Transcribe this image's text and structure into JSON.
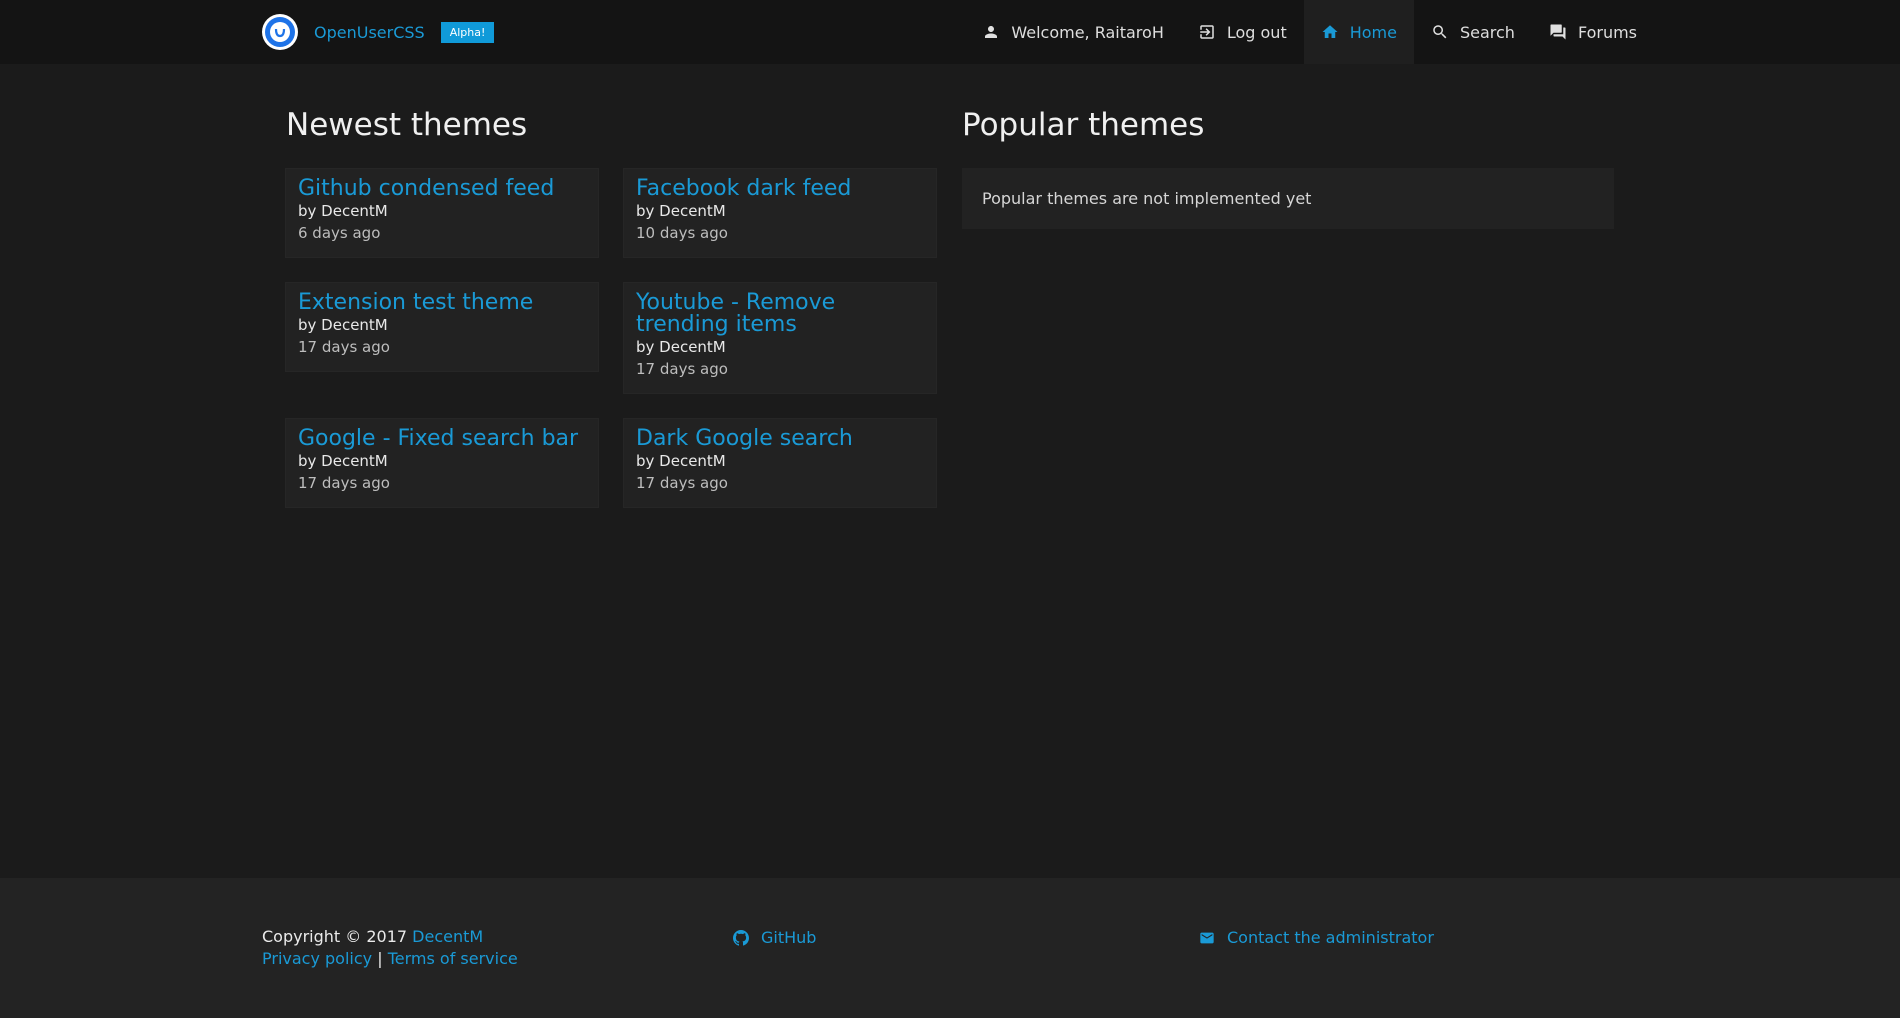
{
  "header": {
    "brand_name": "OpenUserCSS",
    "badge": "Alpha!",
    "nav": {
      "welcome": "Welcome, RaitaroH",
      "logout": "Log out",
      "home": "Home",
      "search": "Search",
      "forums": "Forums"
    }
  },
  "main": {
    "newest_title": "Newest themes",
    "popular_title": "Popular themes",
    "popular_message": "Popular themes are not implemented yet",
    "themes": [
      {
        "title": "Github condensed feed",
        "author": "by DecentM",
        "date": "6 days ago"
      },
      {
        "title": "Facebook dark feed",
        "author": "by DecentM",
        "date": "10 days ago"
      },
      {
        "title": "Extension test theme",
        "author": "by DecentM",
        "date": "17 days ago"
      },
      {
        "title": "Youtube - Remove trending items",
        "author": "by DecentM",
        "date": "17 days ago"
      },
      {
        "title": "Google - Fixed search bar",
        "author": "by DecentM",
        "date": "17 days ago"
      },
      {
        "title": "Dark Google search",
        "author": "by DecentM",
        "date": "17 days ago"
      }
    ]
  },
  "footer": {
    "copyright": "Copyright © 2017",
    "author_link": "DecentM",
    "privacy": "Privacy policy",
    "separator": "|",
    "terms": "Terms of service",
    "github": "GitHub",
    "contact": "Contact the administrator"
  },
  "colors": {
    "accent": "#1a9ad6",
    "background": "#1b1b1b",
    "card": "#222222",
    "badge": "#109ad9"
  },
  "icons": [
    "logo-icon",
    "user-icon",
    "logout-icon",
    "home-icon",
    "search-icon",
    "forum-icon",
    "github-icon",
    "mail-icon"
  ]
}
